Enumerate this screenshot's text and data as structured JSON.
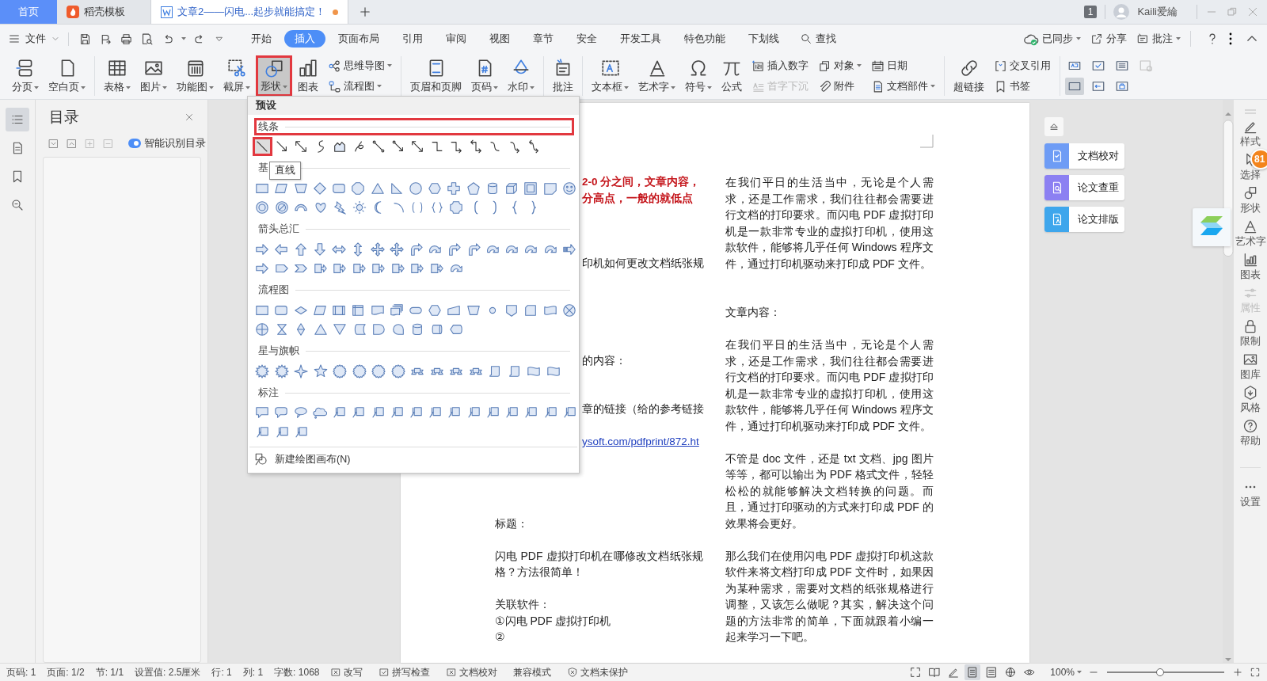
{
  "tabs": [
    {
      "label": "首页",
      "kind": "home",
      "selected": false,
      "unsaved": false
    },
    {
      "label": "稻壳模板",
      "kind": "template",
      "selected": false,
      "unsaved": false
    },
    {
      "label": "文章2——闪电...起步就能搞定！",
      "kind": "document",
      "selected": true,
      "unsaved": true
    }
  ],
  "account": {
    "count": "1",
    "user": "Kaili爱綸"
  },
  "menu_bar": {
    "file": "文件",
    "tabs": [
      {
        "label": "开始",
        "selected": false
      },
      {
        "label": "插入",
        "selected": true
      },
      {
        "label": "页面布局",
        "selected": false
      },
      {
        "label": "引用",
        "selected": false
      },
      {
        "label": "审阅",
        "selected": false
      },
      {
        "label": "视图",
        "selected": false
      },
      {
        "label": "章节",
        "selected": false
      },
      {
        "label": "安全",
        "selected": false
      },
      {
        "label": "开发工具",
        "selected": false
      },
      {
        "label": "特色功能",
        "selected": false
      },
      {
        "label": "下划线",
        "selected": false
      }
    ],
    "search": "查找",
    "actions": [
      {
        "label": "已同步",
        "dropdown": true
      },
      {
        "label": "分享",
        "dropdown": false
      },
      {
        "label": "批注",
        "dropdown": true
      }
    ]
  },
  "ribbon": {
    "groups": [
      [
        {
          "kind": "large",
          "label": "分页",
          "dropdown": true,
          "pressed": false,
          "highlighted": false
        },
        {
          "kind": "large",
          "label": "空白页",
          "dropdown": true,
          "pressed": false,
          "highlighted": false
        }
      ],
      [
        {
          "kind": "large",
          "label": "表格",
          "dropdown": true,
          "pressed": false,
          "highlighted": false
        },
        {
          "kind": "large",
          "label": "图片",
          "dropdown": true,
          "pressed": false,
          "highlighted": false
        },
        {
          "kind": "large",
          "label": "功能图",
          "dropdown": true,
          "pressed": false,
          "highlighted": false
        },
        {
          "kind": "large",
          "label": "截屏",
          "dropdown": true,
          "pressed": false,
          "highlighted": false
        },
        {
          "kind": "large",
          "label": "形状",
          "dropdown": true,
          "pressed": true,
          "highlighted": true
        },
        {
          "kind": "large",
          "label": "图表",
          "dropdown": false,
          "pressed": false,
          "highlighted": false
        },
        {
          "kind": "stack",
          "items": [
            {
              "label": "思维导图",
              "dropdown": true,
              "disabled": false
            },
            {
              "label": "流程图",
              "dropdown": true,
              "disabled": false
            }
          ]
        }
      ],
      [
        {
          "kind": "large",
          "label": "页眉和页脚",
          "dropdown": false,
          "pressed": false,
          "highlighted": false
        },
        {
          "kind": "large",
          "label": "页码",
          "dropdown": true,
          "pressed": false,
          "highlighted": false
        },
        {
          "kind": "large",
          "label": "水印",
          "dropdown": true,
          "pressed": false,
          "highlighted": false
        }
      ],
      [
        {
          "kind": "large",
          "label": "批注",
          "dropdown": false,
          "pressed": false,
          "highlighted": false
        }
      ],
      [
        {
          "kind": "large",
          "label": "文本框",
          "dropdown": true,
          "pressed": false,
          "highlighted": false
        },
        {
          "kind": "large",
          "label": "艺术字",
          "dropdown": true,
          "pressed": false,
          "highlighted": false
        },
        {
          "kind": "large",
          "label": "符号",
          "dropdown": true,
          "pressed": false,
          "highlighted": false
        },
        {
          "kind": "large",
          "label": "公式",
          "dropdown": false,
          "pressed": false,
          "highlighted": false
        },
        {
          "kind": "stack",
          "items": [
            {
              "label": "插入数字",
              "dropdown": false,
              "disabled": false
            },
            {
              "label": "首字下沉",
              "dropdown": false,
              "disabled": true
            }
          ]
        },
        {
          "kind": "stack",
          "items": [
            {
              "label": "对象",
              "dropdown": true,
              "disabled": false
            },
            {
              "label": "附件",
              "dropdown": false,
              "disabled": false
            }
          ]
        },
        {
          "kind": "stack",
          "items": [
            {
              "label": "日期",
              "dropdown": false,
              "disabled": false
            },
            {
              "label": "文档部件",
              "dropdown": true,
              "disabled": false
            }
          ]
        }
      ],
      [
        {
          "kind": "large",
          "label": "超链接",
          "dropdown": false,
          "pressed": false,
          "highlighted": false
        },
        {
          "kind": "stack",
          "items": [
            {
              "label": "交叉引用",
              "dropdown": false,
              "disabled": false
            },
            {
              "label": "书签",
              "dropdown": false,
              "disabled": false
            }
          ]
        }
      ],
      [
        {
          "kind": "grid",
          "items": [
            {
              "selected": false,
              "disabled": false
            },
            {
              "selected": false,
              "disabled": false
            },
            {
              "selected": false,
              "disabled": false
            },
            {
              "selected": false,
              "disabled": true
            },
            {
              "selected": true,
              "disabled": false
            },
            {
              "selected": false,
              "disabled": false
            },
            {
              "selected": false,
              "disabled": false
            }
          ]
        }
      ]
    ]
  },
  "nav_rail": [
    {
      "selected": true
    },
    {
      "selected": false
    },
    {
      "selected": false
    },
    {
      "selected": false
    }
  ],
  "toc_pane": {
    "title": "目录",
    "smart_detect": "智能识别目录"
  },
  "document": {
    "left_column": [
      {
        "kind": "text",
        "text": "2-0 分之间，文章内容，",
        "clipped": true,
        "emphasis": true
      },
      {
        "kind": "text",
        "text": "分高点，一般的就低点",
        "clipped": true,
        "emphasis": true
      },
      {
        "kind": "blank"
      },
      {
        "kind": "blank"
      },
      {
        "kind": "blank"
      },
      {
        "kind": "text",
        "text": "印机如何更改文档纸张规",
        "clipped": true,
        "emphasis": false
      },
      {
        "kind": "blank"
      },
      {
        "kind": "blank"
      },
      {
        "kind": "blank"
      },
      {
        "kind": "blank"
      },
      {
        "kind": "blank"
      },
      {
        "kind": "text",
        "text": "的内容：",
        "clipped": true,
        "emphasis": false
      },
      {
        "kind": "blank"
      },
      {
        "kind": "blank"
      },
      {
        "kind": "text",
        "text": "章的链接（给的参考链接",
        "clipped": true,
        "emphasis": false
      },
      {
        "kind": "blank"
      },
      {
        "kind": "link",
        "text": "ysoft.com/pdfprint/872.ht",
        "clipped": true,
        "emphasis": false
      },
      {
        "kind": "blank"
      },
      {
        "kind": "blank"
      },
      {
        "kind": "blank"
      },
      {
        "kind": "blank"
      },
      {
        "kind": "text",
        "text": "标题：",
        "clipped": false,
        "emphasis": false
      },
      {
        "kind": "blank"
      },
      {
        "kind": "text",
        "text": "闪电 PDF 虚拟打印机在哪修改文档纸张规格？方法很简单！",
        "clipped": false,
        "emphasis": false
      },
      {
        "kind": "blank"
      },
      {
        "kind": "text",
        "text": "关联软件：",
        "clipped": false,
        "emphasis": false
      },
      {
        "kind": "text",
        "text": "①闪电 PDF 虚拟打印机",
        "clipped": false,
        "emphasis": false
      },
      {
        "kind": "text",
        "text": "②",
        "clipped": false,
        "emphasis": false
      }
    ],
    "right_column": [
      {
        "kind": "text",
        "text": "在我们平日的生活当中，无论是个人需求，还是工作需求，我们往往都会需要进行文档的打印要求。而闪电 PDF 虚拟打印机是一款非常专业的虚拟打印机，使用这款软件，能够将几乎任何 Windows 程序文件，通过打印机驱动来打印成 PDF 文件。"
      },
      {
        "kind": "blank"
      },
      {
        "kind": "blank"
      },
      {
        "kind": "text",
        "text": "文章内容："
      },
      {
        "kind": "blank"
      },
      {
        "kind": "text",
        "text": "在我们平日的生活当中，无论是个人需求，还是工作需求，我们往往都会需要进行文档的打印要求。而闪电 PDF 虚拟打印机是一款非常专业的虚拟打印机，使用这款软件，能够将几乎任何 Windows 程序文件，通过打印机驱动来打印成 PDF 文件。"
      },
      {
        "kind": "blank"
      },
      {
        "kind": "text",
        "text": "不管是 doc 文件，还是 txt 文档、jpg 图片等等，都可以输出为 PDF 格式文件，轻轻松松的就能够解决文档转换的问题。而且，通过打印驱动的方式来打印成 PDF 的效果将会更好。"
      },
      {
        "kind": "blank"
      },
      {
        "kind": "text",
        "text": "那么我们在使用闪电 PDF 虚拟打印机这款软件来将文档打印成 PDF 文件时，如果因为某种需求，需要对文档的纸张规格进行调整，又该怎么做呢？其实，解决这个问题的方法非常的简单，下面就跟着小编一起来学习一下吧。"
      }
    ]
  },
  "shapes_menu": {
    "header": "预设",
    "lines": {
      "title": "线条",
      "highlighted": true,
      "shapes": [
        {
          "kind": "line",
          "selected": true,
          "highlighted": true
        },
        {
          "kind": "arrow",
          "selected": false,
          "highlighted": false
        },
        {
          "kind": "double-arrow",
          "selected": false,
          "highlighted": false
        },
        {
          "kind": "curve",
          "selected": false,
          "highlighted": false
        },
        {
          "kind": "freeform",
          "selected": false,
          "highlighted": false
        },
        {
          "kind": "scribble",
          "selected": false,
          "highlighted": false
        },
        {
          "kind": "dot-line",
          "selected": false,
          "highlighted": false
        },
        {
          "kind": "dot-arrow",
          "selected": false,
          "highlighted": false
        },
        {
          "kind": "dot-double-arrow",
          "selected": false,
          "highlighted": false
        },
        {
          "kind": "elbow",
          "selected": false,
          "highlighted": false
        },
        {
          "kind": "elbow-arrow",
          "selected": false,
          "highlighted": false
        },
        {
          "kind": "elbow-double-arrow",
          "selected": false,
          "highlighted": false
        },
        {
          "kind": "curved-connector",
          "selected": false,
          "highlighted": false
        },
        {
          "kind": "curved-arrow",
          "selected": false,
          "highlighted": false
        },
        {
          "kind": "curved-double-arrow",
          "selected": false,
          "highlighted": false
        }
      ]
    },
    "tooltip": "直线",
    "sections": [
      {
        "title": "基",
        "rows": [
          [
            {
              "kind": "rect"
            },
            {
              "kind": "parallelogram"
            },
            {
              "kind": "trapezoid"
            },
            {
              "kind": "diamond"
            },
            {
              "kind": "rounded-rect"
            },
            {
              "kind": "octagon"
            },
            {
              "kind": "triangle"
            },
            {
              "kind": "right-triangle"
            },
            {
              "kind": "circle"
            },
            {
              "kind": "hexagon"
            },
            {
              "kind": "cross"
            },
            {
              "kind": "pentagon"
            },
            {
              "kind": "cylinder"
            },
            {
              "kind": "cube"
            },
            {
              "kind": "frame"
            },
            {
              "kind": "folded-corner"
            },
            {
              "kind": "smiley"
            }
          ],
          [
            {
              "kind": "donut"
            },
            {
              "kind": "no-symbol"
            },
            {
              "kind": "block-arc"
            },
            {
              "kind": "heart"
            },
            {
              "kind": "lightning"
            },
            {
              "kind": "sun"
            },
            {
              "kind": "moon"
            },
            {
              "kind": "arc"
            },
            {
              "kind": "double-bracket"
            },
            {
              "kind": "double-brace"
            },
            {
              "kind": "plaque"
            },
            {
              "kind": "left-bracket"
            },
            {
              "kind": "right-bracket"
            },
            {
              "kind": "left-brace"
            },
            {
              "kind": "right-brace"
            }
          ]
        ]
      },
      {
        "title": "箭头总汇",
        "rows": [
          [
            {
              "kind": "right-arrow"
            },
            {
              "kind": "left-arrow"
            },
            {
              "kind": "up-arrow"
            },
            {
              "kind": "down-arrow"
            },
            {
              "kind": "left-right-arrow"
            },
            {
              "kind": "up-down-arrow"
            },
            {
              "kind": "quad-arrow"
            },
            {
              "kind": "quad-arrow"
            },
            {
              "kind": "bent-arrow"
            },
            {
              "kind": "curved-block-arrow"
            },
            {
              "kind": "bent-arrow"
            },
            {
              "kind": "bent-arrow"
            },
            {
              "kind": "curved-block-arrow"
            },
            {
              "kind": "curved-block-arrow"
            },
            {
              "kind": "curved-block-arrow"
            },
            {
              "kind": "curved-block-arrow"
            },
            {
              "kind": "striped-arrow"
            }
          ],
          [
            {
              "kind": "right-arrow"
            },
            {
              "kind": "pentagon-arrow"
            },
            {
              "kind": "chevron"
            },
            {
              "kind": "callout-arrow"
            },
            {
              "kind": "callout-arrow"
            },
            {
              "kind": "callout-arrow"
            },
            {
              "kind": "callout-arrow"
            },
            {
              "kind": "callout-arrow"
            },
            {
              "kind": "callout-arrow"
            },
            {
              "kind": "callout-arrow"
            },
            {
              "kind": "curved-block-arrow"
            }
          ]
        ]
      },
      {
        "title": "流程图",
        "rows": [
          [
            {
              "kind": "rect"
            },
            {
              "kind": "rounded-rect"
            },
            {
              "kind": "decision"
            },
            {
              "kind": "parallelogram"
            },
            {
              "kind": "predefined"
            },
            {
              "kind": "internal-storage"
            },
            {
              "kind": "document"
            },
            {
              "kind": "multi-document"
            },
            {
              "kind": "terminator"
            },
            {
              "kind": "hexagon"
            },
            {
              "kind": "manual-input"
            },
            {
              "kind": "manual-operation"
            },
            {
              "kind": "small-circle"
            },
            {
              "kind": "offpage"
            },
            {
              "kind": "card"
            },
            {
              "kind": "punched-tape"
            },
            {
              "kind": "summing-junction"
            }
          ],
          [
            {
              "kind": "or-symbol"
            },
            {
              "kind": "hourglass"
            },
            {
              "kind": "sort"
            },
            {
              "kind": "triangle"
            },
            {
              "kind": "inverted-triangle"
            },
            {
              "kind": "stored-data"
            },
            {
              "kind": "delay"
            },
            {
              "kind": "sequential-access"
            },
            {
              "kind": "cylinder"
            },
            {
              "kind": "direct-access"
            },
            {
              "kind": "display"
            }
          ]
        ]
      },
      {
        "title": "星与旗帜",
        "rows": [
          [
            {
              "kind": "burst"
            },
            {
              "kind": "burst"
            },
            {
              "kind": "star4"
            },
            {
              "kind": "star5"
            },
            {
              "kind": "seal"
            },
            {
              "kind": "seal"
            },
            {
              "kind": "seal"
            },
            {
              "kind": "seal"
            },
            {
              "kind": "ribbon"
            },
            {
              "kind": "ribbon"
            },
            {
              "kind": "ribbon"
            },
            {
              "kind": "ribbon"
            },
            {
              "kind": "scroll"
            },
            {
              "kind": "scroll"
            },
            {
              "kind": "wave"
            },
            {
              "kind": "wave"
            }
          ]
        ]
      },
      {
        "title": "标注",
        "rows": [
          [
            {
              "kind": "rect-callout"
            },
            {
              "kind": "rounded-callout"
            },
            {
              "kind": "oval-callout"
            },
            {
              "kind": "cloud-callout"
            },
            {
              "kind": "line-callout"
            },
            {
              "kind": "line-callout"
            },
            {
              "kind": "line-callout"
            },
            {
              "kind": "line-callout"
            },
            {
              "kind": "line-callout"
            },
            {
              "kind": "line-callout"
            },
            {
              "kind": "line-callout"
            },
            {
              "kind": "line-callout"
            },
            {
              "kind": "line-callout"
            },
            {
              "kind": "line-callout"
            },
            {
              "kind": "line-callout"
            },
            {
              "kind": "line-callout"
            },
            {
              "kind": "line-callout"
            }
          ],
          [
            {
              "kind": "line-callout"
            },
            {
              "kind": "line-callout"
            },
            {
              "kind": "line-callout"
            }
          ]
        ]
      }
    ],
    "footer": "新建绘图画布(N)"
  },
  "assist_panel": [
    {
      "label": "文档校对",
      "color": "#6e9cf5"
    },
    {
      "label": "论文查重",
      "color": "#8c80f2"
    },
    {
      "label": "论文排版",
      "color": "#3ea6ec"
    }
  ],
  "sidebar": {
    "items": [
      {
        "label": "样式",
        "disabled": false
      },
      {
        "label": "选择",
        "disabled": false
      },
      {
        "label": "形状",
        "disabled": false
      },
      {
        "label": "艺术字",
        "disabled": false
      },
      {
        "label": "图表",
        "disabled": false
      },
      {
        "label": "属性",
        "disabled": true
      },
      {
        "label": "限制",
        "disabled": false
      },
      {
        "label": "图库",
        "disabled": false
      },
      {
        "label": "风格",
        "disabled": false
      },
      {
        "label": "帮助",
        "disabled": false
      },
      {
        "label": "设置",
        "disabled": false
      }
    ],
    "badge": "81"
  },
  "status_bar": {
    "items": [
      {
        "kind": "field",
        "text": "页码: 1"
      },
      {
        "kind": "field",
        "text": "页面: 1/2"
      },
      {
        "kind": "field",
        "text": "节: 1/1"
      },
      {
        "kind": "field",
        "text": "设置值: 2.5厘米"
      },
      {
        "kind": "field",
        "text": "行: 1"
      },
      {
        "kind": "field",
        "text": "列: 1"
      },
      {
        "kind": "field",
        "text": "字数: 1068"
      },
      {
        "kind": "check-off",
        "text": "改写"
      },
      {
        "kind": "check-on",
        "text": "拼写检查"
      },
      {
        "kind": "check-off",
        "text": "文档校对"
      },
      {
        "kind": "plain",
        "text": "兼容模式"
      },
      {
        "kind": "shield",
        "text": "文档未保护"
      }
    ],
    "views": [
      {
        "selected": false
      },
      {
        "selected": false
      },
      {
        "selected": false
      },
      {
        "selected": true
      },
      {
        "selected": false
      },
      {
        "selected": false
      },
      {
        "selected": false
      }
    ],
    "zoom": "100%",
    "zoom_slider": {
      "level": 0.45
    }
  }
}
